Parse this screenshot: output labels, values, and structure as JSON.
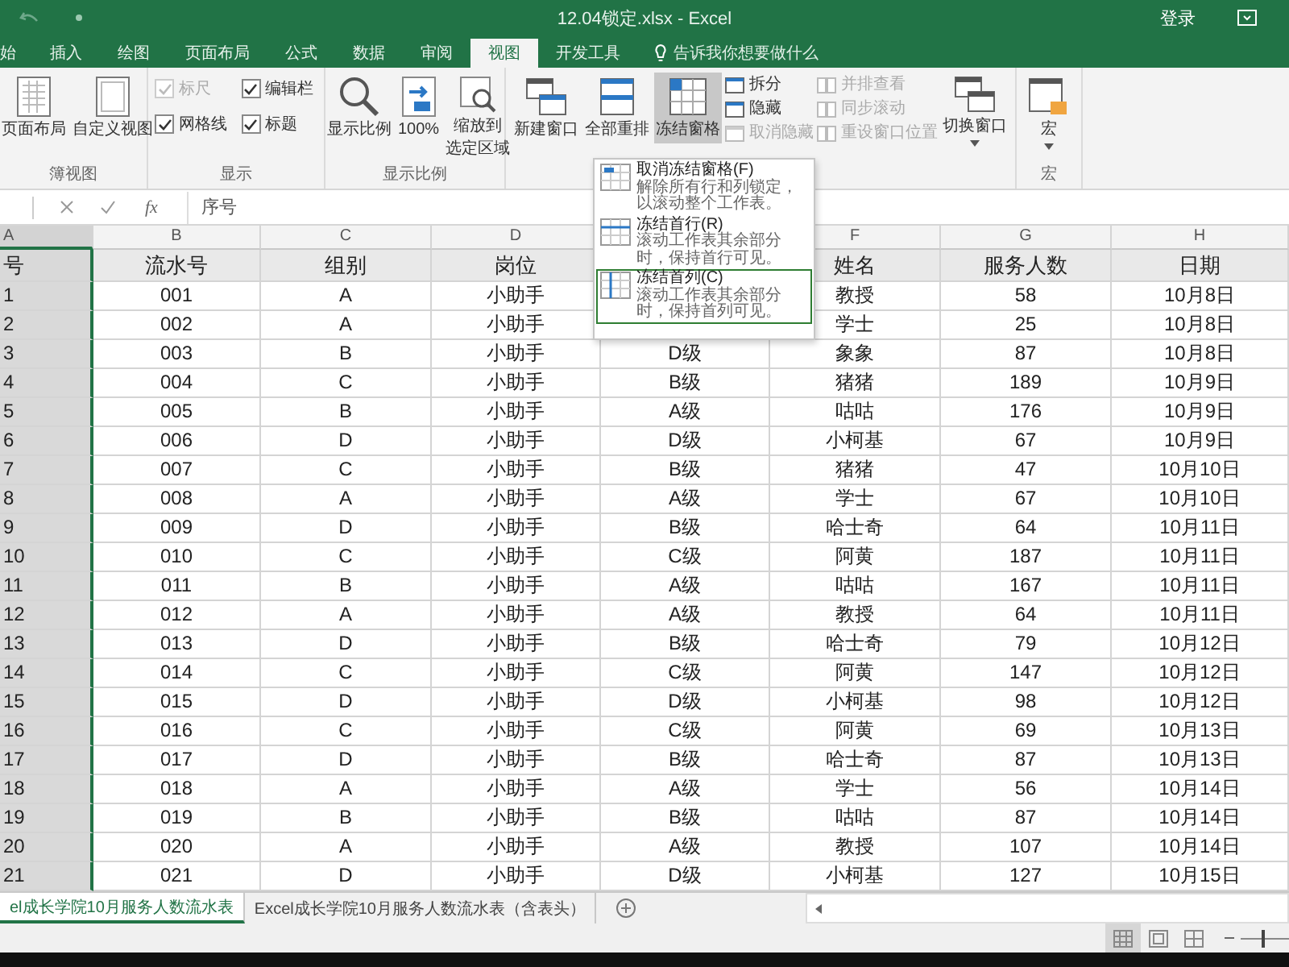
{
  "title_bar": {
    "title": "12.04锁定.xlsx - Excel",
    "sign_in": "登录"
  },
  "ribbon_tabs": [
    {
      "label": "始",
      "selected": false
    },
    {
      "label": "插入",
      "selected": false
    },
    {
      "label": "绘图",
      "selected": false
    },
    {
      "label": "页面布局",
      "selected": false
    },
    {
      "label": "公式",
      "selected": false
    },
    {
      "label": "数据",
      "selected": false
    },
    {
      "label": "审阅",
      "selected": false
    },
    {
      "label": "视图",
      "selected": true
    },
    {
      "label": "开发工具",
      "selected": false
    }
  ],
  "tell_me": "告诉我你想要做什么",
  "workbook_views": {
    "label": "簿视图",
    "buttons": [
      "页面布局",
      "自定义视图"
    ]
  },
  "show": {
    "label": "显示",
    "checkboxes": [
      {
        "label": "标尺",
        "checked": true,
        "disabled": true
      },
      {
        "label": "网格线",
        "checked": true,
        "disabled": false
      },
      {
        "label": "编辑栏",
        "checked": true,
        "disabled": false
      },
      {
        "label": "标题",
        "checked": true,
        "disabled": false
      }
    ]
  },
  "zoom": {
    "label": "显示比例",
    "buttons": [
      "显示比例",
      "100%"
    ],
    "zoom_to_selection": [
      "缩放到",
      "选定区域"
    ]
  },
  "window": {
    "buttons": [
      {
        "label": "新建窗口",
        "selected": false
      },
      {
        "label": "全部重排",
        "selected": false
      },
      {
        "label": "冻结窗格",
        "selected": true
      }
    ],
    "small_buttons": [
      {
        "label": "拆分",
        "disabled": false
      },
      {
        "label": "隐藏",
        "disabled": false
      },
      {
        "label": "取消隐藏",
        "disabled": true
      },
      {
        "label": "并排查看",
        "disabled": true
      },
      {
        "label": "同步滚动",
        "disabled": true
      },
      {
        "label": "重设窗口位置",
        "disabled": true
      }
    ],
    "switch": "切换窗口"
  },
  "macros": {
    "label": "宏",
    "button": "宏"
  },
  "freeze_menu": [
    {
      "title": "取消冻结窗格(F)",
      "description": "解除所有行和列锁定，以滚动整个工作表。",
      "selected": false
    },
    {
      "title": "冻结首行(R)",
      "description": "滚动工作表其余部分时，保持首行可见。",
      "selected": false
    },
    {
      "title": "冻结首列(C)",
      "description": "滚动工作表其余部分时，保持首列可见。",
      "selected": true
    }
  ],
  "formula_bar": {
    "fx": "fx",
    "content": "序号"
  },
  "table": {
    "column_letters": {
      "A": "A",
      "B": "B",
      "C": "C",
      "D": "D",
      "F": "F",
      "G": "G",
      "H": "H"
    },
    "header": {
      "A": "号",
      "B": "流水号",
      "C": "组别",
      "D": "岗位",
      "F": "姓名",
      "G": "服务人数",
      "H": "日期"
    },
    "rows": [
      {
        "A": "1",
        "B": "001",
        "C": "A",
        "D": "小助手",
        "F": "教授",
        "G": "58",
        "H": "10月8日"
      },
      {
        "A": "2",
        "B": "002",
        "C": "A",
        "D": "小助手",
        "F": "学士",
        "G": "25",
        "H": "10月8日"
      },
      {
        "A": "3",
        "B": "003",
        "C": "B",
        "D": "小助手",
        "E": "D级",
        "F": "象象",
        "G": "87",
        "H": "10月8日"
      },
      {
        "A": "4",
        "B": "004",
        "C": "C",
        "D": "小助手",
        "E": "B级",
        "F": "猪猪",
        "G": "189",
        "H": "10月9日"
      },
      {
        "A": "5",
        "B": "005",
        "C": "B",
        "D": "小助手",
        "E": "A级",
        "F": "咕咕",
        "G": "176",
        "H": "10月9日"
      },
      {
        "A": "6",
        "B": "006",
        "C": "D",
        "D": "小助手",
        "E": "D级",
        "F": "小柯基",
        "G": "67",
        "H": "10月9日"
      },
      {
        "A": "7",
        "B": "007",
        "C": "C",
        "D": "小助手",
        "E": "B级",
        "F": "猪猪",
        "G": "47",
        "H": "10月10日"
      },
      {
        "A": "8",
        "B": "008",
        "C": "A",
        "D": "小助手",
        "E": "A级",
        "F": "学士",
        "G": "67",
        "H": "10月10日"
      },
      {
        "A": "9",
        "B": "009",
        "C": "D",
        "D": "小助手",
        "E": "B级",
        "F": "哈士奇",
        "G": "64",
        "H": "10月11日"
      },
      {
        "A": "10",
        "B": "010",
        "C": "C",
        "D": "小助手",
        "E": "C级",
        "F": "阿黄",
        "G": "187",
        "H": "10月11日"
      },
      {
        "A": "11",
        "B": "011",
        "C": "B",
        "D": "小助手",
        "E": "A级",
        "F": "咕咕",
        "G": "167",
        "H": "10月11日"
      },
      {
        "A": "12",
        "B": "012",
        "C": "A",
        "D": "小助手",
        "E": "A级",
        "F": "教授",
        "G": "64",
        "H": "10月11日"
      },
      {
        "A": "13",
        "B": "013",
        "C": "D",
        "D": "小助手",
        "E": "B级",
        "F": "哈士奇",
        "G": "79",
        "H": "10月12日"
      },
      {
        "A": "14",
        "B": "014",
        "C": "C",
        "D": "小助手",
        "E": "C级",
        "F": "阿黄",
        "G": "147",
        "H": "10月12日"
      },
      {
        "A": "15",
        "B": "015",
        "C": "D",
        "D": "小助手",
        "E": "D级",
        "F": "小柯基",
        "G": "98",
        "H": "10月12日"
      },
      {
        "A": "16",
        "B": "016",
        "C": "C",
        "D": "小助手",
        "E": "C级",
        "F": "阿黄",
        "G": "69",
        "H": "10月13日"
      },
      {
        "A": "17",
        "B": "017",
        "C": "D",
        "D": "小助手",
        "E": "B级",
        "F": "哈士奇",
        "G": "87",
        "H": "10月13日"
      },
      {
        "A": "18",
        "B": "018",
        "C": "A",
        "D": "小助手",
        "E": "A级",
        "F": "学士",
        "G": "56",
        "H": "10月14日"
      },
      {
        "A": "19",
        "B": "019",
        "C": "B",
        "D": "小助手",
        "E": "B级",
        "F": "咕咕",
        "G": "87",
        "H": "10月14日"
      },
      {
        "A": "20",
        "B": "020",
        "C": "A",
        "D": "小助手",
        "E": "A级",
        "F": "教授",
        "G": "107",
        "H": "10月14日"
      },
      {
        "A": "21",
        "B": "021",
        "C": "D",
        "D": "小助手",
        "E": "D级",
        "F": "小柯基",
        "G": "127",
        "H": "10月15日"
      }
    ]
  },
  "sheet_tabs": [
    {
      "label": "el成长学院10月服务人数流水表",
      "selected": true
    },
    {
      "label": "Excel成长学院10月服务人数流水表（含表头）",
      "selected": false
    }
  ],
  "view_buttons": [
    {
      "selected": true
    },
    {
      "selected": false
    },
    {
      "selected": false
    }
  ],
  "zoom_slider": {
    "level": 0.45
  }
}
